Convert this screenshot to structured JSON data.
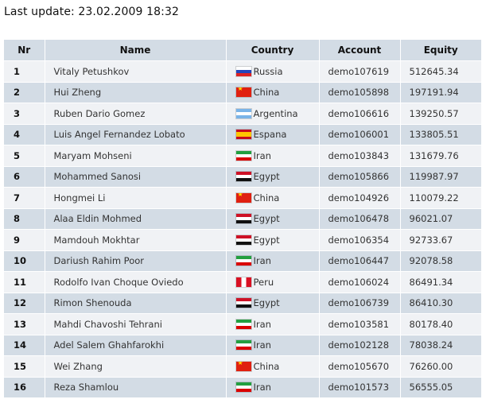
{
  "last_update": "Last update: 23.02.2009 18:32",
  "table": {
    "headers": [
      "Nr",
      "Name",
      "Country",
      "Account",
      "Equity"
    ],
    "rows": [
      {
        "nr": "1",
        "name": "Vitaly Petushkov",
        "country": "Russia",
        "flag": "russia",
        "account": "demo107619",
        "equity": "512645.34"
      },
      {
        "nr": "2",
        "name": "Hui Zheng",
        "country": "China",
        "flag": "china",
        "account": "demo105898",
        "equity": "197191.94"
      },
      {
        "nr": "3",
        "name": "Ruben Dario Gomez",
        "country": "Argentina",
        "flag": "argentina",
        "account": "demo106616",
        "equity": "139250.57"
      },
      {
        "nr": "4",
        "name": "Luis Angel Fernandez Lobato",
        "country": "Espana",
        "flag": "espana",
        "account": "demo106001",
        "equity": "133805.51"
      },
      {
        "nr": "5",
        "name": "Maryam Mohseni",
        "country": "Iran",
        "flag": "iran",
        "account": "demo103843",
        "equity": "131679.76"
      },
      {
        "nr": "6",
        "name": "Mohammed Sanosi",
        "country": "Egypt",
        "flag": "egypt",
        "account": "demo105866",
        "equity": "119987.97"
      },
      {
        "nr": "7",
        "name": "Hongmei Li",
        "country": "China",
        "flag": "china",
        "account": "demo104926",
        "equity": "110079.22"
      },
      {
        "nr": "8",
        "name": "Alaa Eldin Mohmed",
        "country": "Egypt",
        "flag": "egypt",
        "account": "demo106478",
        "equity": "96021.07"
      },
      {
        "nr": "9",
        "name": "Mamdouh Mokhtar",
        "country": "Egypt",
        "flag": "egypt",
        "account": "demo106354",
        "equity": "92733.67"
      },
      {
        "nr": "10",
        "name": "Dariush Rahim Poor",
        "country": "Iran",
        "flag": "iran",
        "account": "demo106447",
        "equity": "92078.58"
      },
      {
        "nr": "11",
        "name": "Rodolfo Ivan Choque Oviedo",
        "country": "Peru",
        "flag": "peru",
        "account": "demo106024",
        "equity": "86491.34"
      },
      {
        "nr": "12",
        "name": "Rimon Shenouda",
        "country": "Egypt",
        "flag": "egypt",
        "account": "demo106739",
        "equity": "86410.30"
      },
      {
        "nr": "13",
        "name": "Mahdi Chavoshi Tehrani",
        "country": "Iran",
        "flag": "iran",
        "account": "demo103581",
        "equity": "80178.40"
      },
      {
        "nr": "14",
        "name": "Adel Salem Ghahfarokhi",
        "country": "Iran",
        "flag": "iran",
        "account": "demo102128",
        "equity": "78038.24"
      },
      {
        "nr": "15",
        "name": "Wei Zhang",
        "country": "China",
        "flag": "china",
        "account": "demo105670",
        "equity": "76260.00"
      },
      {
        "nr": "16",
        "name": "Reza Shamlou",
        "country": "Iran",
        "flag": "iran",
        "account": "demo101573",
        "equity": "56555.05"
      }
    ]
  }
}
